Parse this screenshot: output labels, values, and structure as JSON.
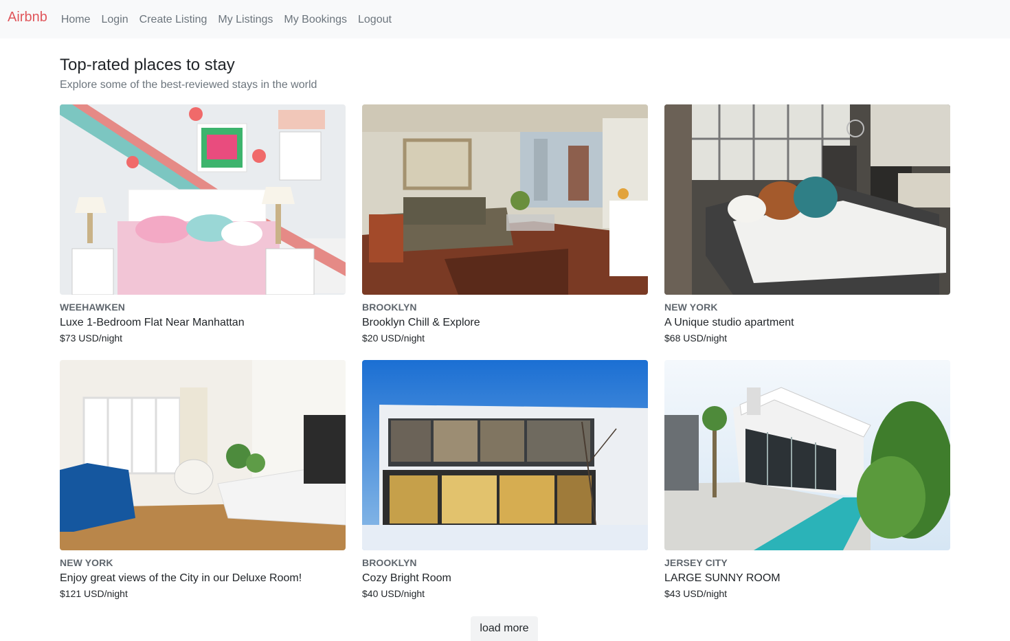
{
  "nav": {
    "brand": "Airbnb",
    "links": [
      "Home",
      "Login",
      "Create Listing",
      "My Listings",
      "My Bookings",
      "Logout"
    ]
  },
  "header": {
    "title": "Top-rated places to stay",
    "subtitle": "Explore some of the best-reviewed stays in the world"
  },
  "listings": [
    {
      "city": "WEEHAWKEN",
      "title": "Luxe 1-Bedroom Flat Near Manhattan",
      "price": "$73 USD/night"
    },
    {
      "city": "BROOKLYN",
      "title": "Brooklyn Chill & Explore",
      "price": "$20 USD/night"
    },
    {
      "city": "NEW YORK",
      "title": "A Unique studio apartment",
      "price": "$68 USD/night"
    },
    {
      "city": "NEW YORK",
      "title": "Enjoy great views of the City in our Deluxe Room!",
      "price": "$121 USD/night"
    },
    {
      "city": "BROOKLYN",
      "title": "Cozy Bright Room",
      "price": "$40 USD/night"
    },
    {
      "city": "JERSEY CITY",
      "title": "LARGE SUNNY ROOM",
      "price": "$43 USD/night"
    }
  ],
  "load_more_label": "load more",
  "colors": {
    "brand": "#e0565b",
    "nav_bg": "#f8f9fa",
    "muted": "#6c757d"
  }
}
